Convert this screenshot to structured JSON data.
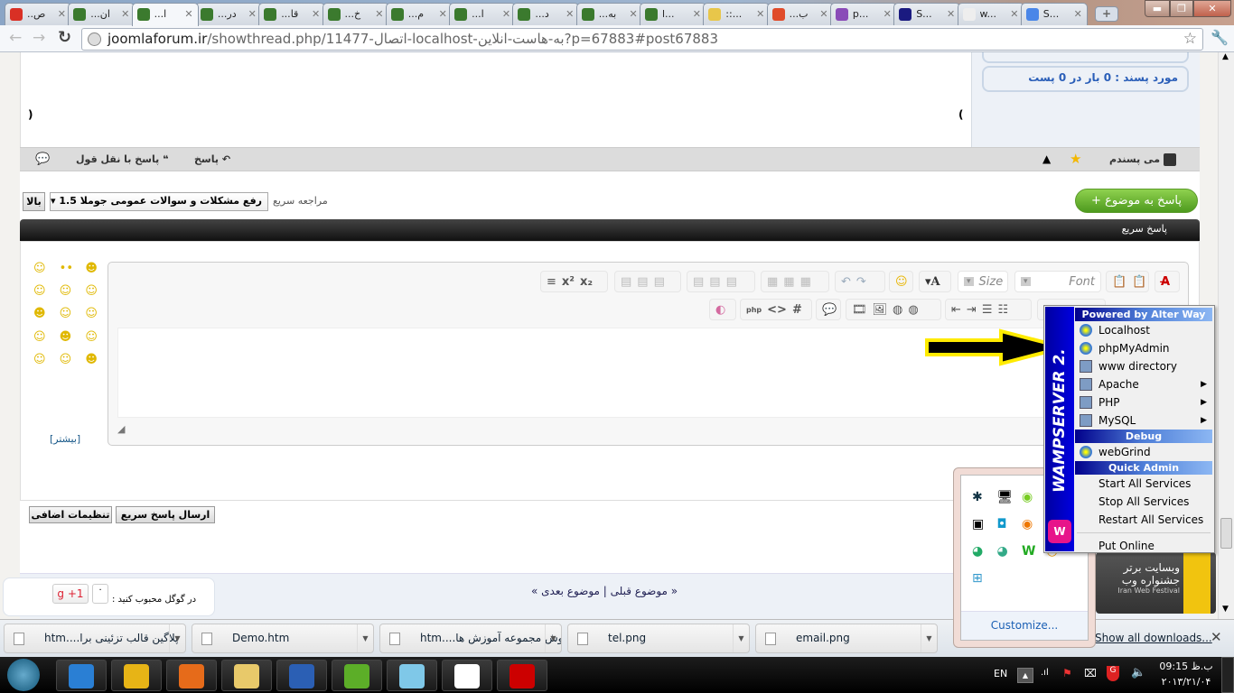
{
  "browser": {
    "tabs": [
      {
        "title": "..ص",
        "icon": "gmail-icon",
        "color": "#d93025"
      },
      {
        "title": "...ان",
        "icon": "joomlaforum-icon",
        "color": "#3b7a2e"
      },
      {
        "title": "...ا",
        "icon": "joomlaforum-icon",
        "color": "#3b7a2e",
        "active": true
      },
      {
        "title": "...در",
        "icon": "joomlaforum-icon",
        "color": "#3b7a2e"
      },
      {
        "title": "...قا",
        "icon": "joomlaforum-icon",
        "color": "#3b7a2e"
      },
      {
        "title": "...خ",
        "icon": "joomlaforum-icon",
        "color": "#3b7a2e"
      },
      {
        "title": "...م",
        "icon": "joomlaforum-icon",
        "color": "#3b7a2e"
      },
      {
        "title": "...ا",
        "icon": "joomlaforum-icon",
        "color": "#3b7a2e"
      },
      {
        "title": "...د",
        "icon": "joomlaforum-icon",
        "color": "#3b7a2e"
      },
      {
        "title": "...به",
        "icon": "joomlaforum-icon",
        "color": "#3b7a2e"
      },
      {
        "title": "l...",
        "icon": "joomlaforum-icon",
        "color": "#3b7a2e"
      },
      {
        "title": "::...",
        "icon": "folder-icon",
        "color": "#e8c64a"
      },
      {
        "title": "...ب",
        "icon": "joomla-icon",
        "color": "#e04b2a"
      },
      {
        "title": "p...",
        "icon": "mail-icon",
        "color": "#8a4bb8"
      },
      {
        "title": "S...",
        "icon": "sans-icon",
        "color": "#1a1a80"
      },
      {
        "title": "w...",
        "icon": "page-icon",
        "color": "#eeeeee"
      },
      {
        "title": "S...",
        "icon": "google-icon",
        "color": "#4a86e8"
      }
    ],
    "url_host": "joomlaforum.ir",
    "url_rest": "/showthread.php/11477-اتصال-localhost-به-هاست-انلاین?p=67883#post67883"
  },
  "post": {
    "liked_box": "مورد پسند : 0 بار در 0 پست",
    "paren_left": "(",
    "paren_right": ")",
    "like_label": "می پسندم",
    "reply_label": "پاسخ",
    "reply_quote_label": "پاسخ با نقل قول"
  },
  "nav": {
    "reply_topic_button": "+ پاسخ به موضوع",
    "quick_nav_label": "مراجعه سریع",
    "quick_nav_value": "رفع مشکلات و سوالات عمومی جوملا 1.5",
    "top_button": "بالا"
  },
  "quick_reply": {
    "title": "پاسخ سریع",
    "font_placeholder": "Font",
    "size_placeholder": "Size",
    "more_smilies": "[بیشتر]",
    "submit_button": "ارسال پاسخ سریع",
    "advanced_button": "تنظیمات اضافی"
  },
  "footer": {
    "prev_next": "« موضوع قبلی | موضوع بعدی »",
    "gplus_label": "در گوگل محبوب کنید :",
    "gplus_count": "۰",
    "gplus_button": "+1"
  },
  "wamp": {
    "brand": "WAMPSERVER 2.",
    "header1": "Powered by Alter Way",
    "items1": [
      {
        "label": "Localhost",
        "icon": "globe-icon"
      },
      {
        "label": "phpMyAdmin",
        "icon": "globe-icon"
      },
      {
        "label": "www directory",
        "icon": "folder-icon"
      },
      {
        "label": "Apache",
        "icon": "folder-icon",
        "submenu": true
      },
      {
        "label": "PHP",
        "icon": "folder-icon",
        "submenu": true
      },
      {
        "label": "MySQL",
        "icon": "folder-icon",
        "submenu": true
      }
    ],
    "header2": "Debug",
    "items2": [
      {
        "label": "webGrind",
        "icon": "globe-icon"
      }
    ],
    "header3": "Quick Admin",
    "items3": [
      "Start All Services",
      "Stop All Services",
      "Restart All Services"
    ],
    "put_online": "Put Online"
  },
  "tray_popup": {
    "customize": "Customize..."
  },
  "downloads": {
    "items": [
      "htm....پلاگین قالب تزئینی برا",
      "Demo.htm",
      "htm....فروش مجموعه آموزش ها",
      "tel.png",
      "email.png"
    ],
    "show_all": "Show all downloads..."
  },
  "taskbar": {
    "apps": [
      "internet-explorer",
      "chrome",
      "firefox",
      "explorer",
      "word",
      "dreamweaver",
      "notepad",
      "app",
      "acrobat"
    ],
    "lang": "EN",
    "time": "09:15 ب.ظ",
    "date": "۲۰۱۳/۲۱/۰۴"
  },
  "ad": {
    "text": "وبسایت برتر جشنواره وب",
    "sub": "Iran Web Festival"
  }
}
